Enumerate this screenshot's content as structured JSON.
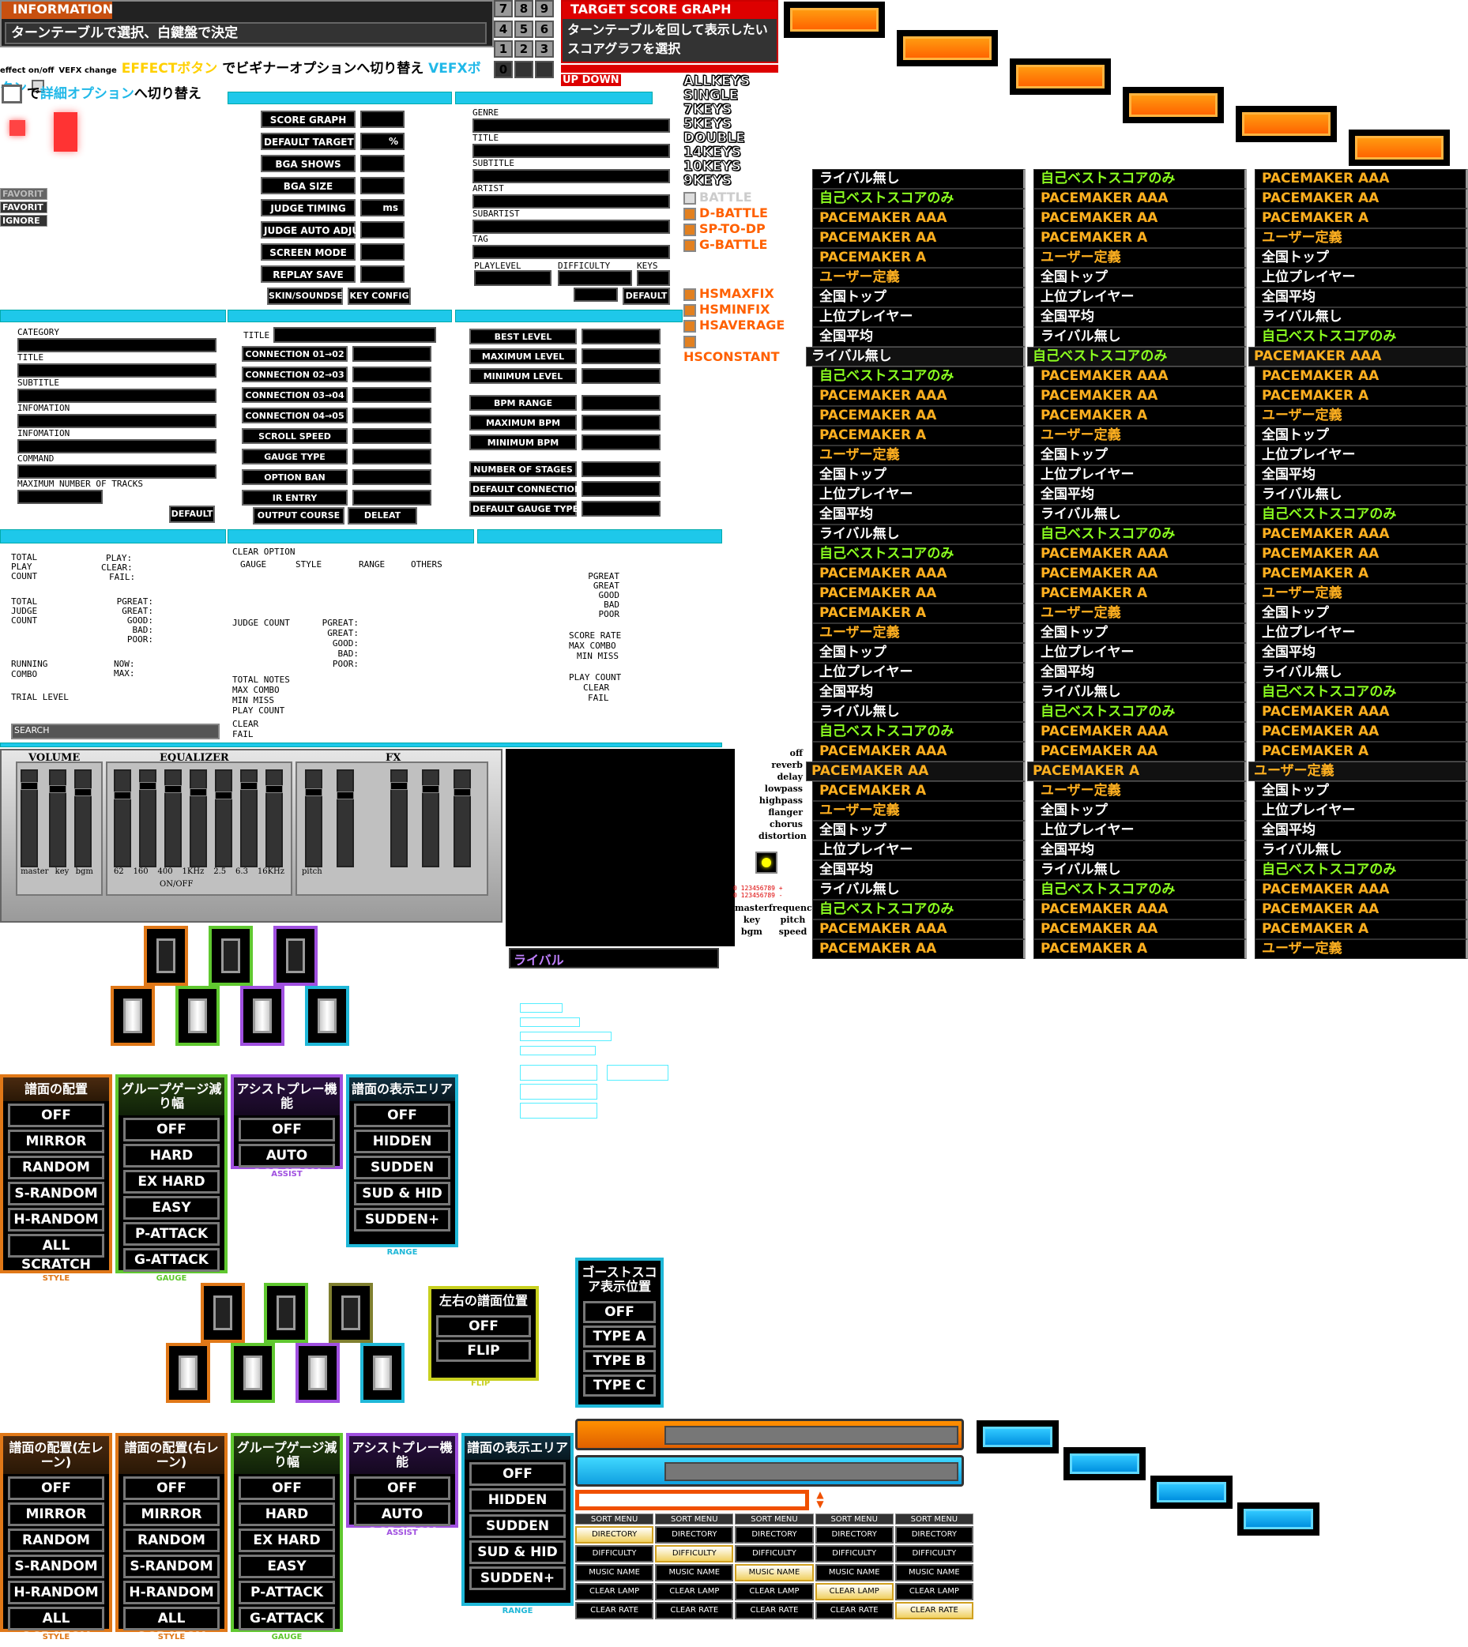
{
  "info": {
    "header": "INFORMATION",
    "line1": "ターンテーブルで選択、白鍵盤で決定",
    "line2a": "effect on/off",
    "line2b": "VEFX change",
    "line2c": "EFFECTボタン",
    "line2d": "でビギナーオプションへ切り替え",
    "line2e": "VEFXボタン",
    "line3a": "で",
    "line3b": "詳細オプション",
    "line3c": "へ切り替え"
  },
  "keypad": [
    "7",
    "8",
    "9",
    "4",
    "5",
    "6",
    "1",
    "2",
    "3",
    "0"
  ],
  "target": {
    "header": "TARGET SCORE GRAPH",
    "line1": "ターンテーブルを回して表示したい",
    "line2": "スコアグラフを選択",
    "updown": "UP DOWN"
  },
  "keysmode": [
    "ALLKEYS",
    "SINGLE",
    "7KEYS",
    "5KEYS",
    "DOUBLE",
    "14KEYS",
    "10KEYS",
    "9KEYS"
  ],
  "battle": [
    "BATTLE",
    "D-BATTLE",
    "SP-TO-DP",
    "G-BATTLE"
  ],
  "hs": [
    "HSMAXFIX",
    "HSMINFIX",
    "HSAVERAGE",
    "HSCONSTANT"
  ],
  "favorite": [
    "FAVORIT",
    "FAVORIT",
    "IGNORE"
  ],
  "settings": {
    "items": [
      "SCORE GRAPH",
      "DEFAULT TARGET",
      "BGA SHOWS",
      "BGA SIZE",
      "JUDGE TIMING",
      "JUDGE AUTO ADJUST",
      "SCREEN MODE",
      "REPLAY SAVE"
    ],
    "units": [
      "",
      "%",
      "",
      "",
      "ms",
      "",
      "",
      ""
    ],
    "skin": "SKIN/SOUNDSET",
    "keyconfig": "KEY CONFIG"
  },
  "songinfo": {
    "labels": [
      "GENRE",
      "TITLE",
      "SUBTITLE",
      "ARTIST",
      "SUBARTIST",
      "TAG"
    ],
    "playlevel": "PLAYLEVEL",
    "difficulty": "DIFFICULTY",
    "keys": "KEYS",
    "default": "DEFAULT"
  },
  "course": {
    "labels": [
      "CATEGORY",
      "TITLE",
      "SUBTITLE",
      "INFOMATION",
      "INFOMATION",
      "COMMAND",
      "MAXIMUM NUMBER OF TRACKS"
    ],
    "default": "DEFAULT"
  },
  "course2": {
    "title": "TITLE",
    "items": [
      "CONNECTION 01→02",
      "CONNECTION 02→03",
      "CONNECTION 03→04",
      "CONNECTION 04→05",
      "SCROLL SPEED",
      "GAUGE TYPE",
      "OPTION BAN",
      "IR ENTRY"
    ],
    "output": "OUTPUT COURSE FILE",
    "delete": "DELEAT COURSE"
  },
  "course3": {
    "items": [
      "BEST LEVEL",
      "MAXIMUM LEVEL",
      "MINIMUM LEVEL",
      "BPM RANGE",
      "MAXIMUM BPM",
      "MINIMUM BPM",
      "NUMBER OF STAGES",
      "DEFAULT CONNECTION",
      "DEFAULT GAUGE TYPE"
    ]
  },
  "stats": {
    "total_play": "TOTAL PLAY COUNT",
    "play": "PLAY:",
    "clear": "CLEAR:",
    "fail": "FAIL:",
    "total_judge": "TOTAL JUDGE COUNT",
    "judges": [
      "PGREAT:",
      "GREAT:",
      "GOOD:",
      "BAD:",
      "POOR:"
    ],
    "running": "RUNNING COMBO",
    "now": "NOW:",
    "max": "MAX:",
    "trial": "TRIAL LEVEL",
    "search": "SEARCH"
  },
  "clearopt": {
    "title": "CLEAR OPTION",
    "gauge": "GAUGE",
    "style": "STYLE",
    "range": "RANGE",
    "others": "OTHERS",
    "judgecount": "JUDGE COUNT",
    "totals": [
      "TOTAL NOTES",
      "MAX COMBO",
      "MIN MISS",
      "PLAY COUNT"
    ],
    "cf": [
      "CLEAR",
      "FAIL"
    ]
  },
  "score": {
    "judges": [
      "PGREAT",
      "GREAT",
      "GOOD",
      "BAD",
      "POOR"
    ],
    "rate": "SCORE RATE",
    "maxcombo": "MAX COMBO",
    "minmiss": "MIN MISS",
    "play": "PLAY COUNT",
    "clear": "CLEAR",
    "fail": "FAIL"
  },
  "mixer": {
    "volume": "VOLUME",
    "equalizer": "EQUALIZER",
    "fx": "FX",
    "vol_labels": [
      "master",
      "key",
      "bgm"
    ],
    "eq_labels": [
      "62",
      "160",
      "400",
      "1KHz",
      "2.5",
      "6.3",
      "16KHz"
    ],
    "onoff": "ON/OFF",
    "pitch": "pitch"
  },
  "fxlist": [
    "off",
    "reverb",
    "delay",
    "lowpass",
    "highpass",
    "flanger",
    "chorus",
    "distortion"
  ],
  "fxbottom": [
    "master",
    "frequency",
    "key",
    "pitch",
    "bgm",
    "speed"
  ],
  "rival": "ライバル",
  "options1": [
    {
      "title": "譜面の配置",
      "items": [
        "OFF",
        "MIRROR",
        "RANDOM",
        "S-RANDOM",
        "H-RANDOM",
        "ALL SCRATCH"
      ],
      "foot": "STYLE",
      "color": "#e07818"
    },
    {
      "title": "グループゲージ減り幅",
      "items": [
        "OFF",
        "HARD",
        "EX HARD",
        "EASY",
        "P-ATTACK",
        "G-ATTACK"
      ],
      "foot": "GAUGE",
      "color": "#60c830"
    },
    {
      "title": "アシストプレー機能",
      "items": [
        "OFF",
        "AUTO SCRATCH"
      ],
      "foot": "ASSIST",
      "color": "#a050e0"
    },
    {
      "title": "譜面の表示エリア",
      "items": [
        "OFF",
        "HIDDEN",
        "SUDDEN",
        "SUD & HID",
        "SUDDEN+"
      ],
      "foot": "RANGE",
      "color": "#20b8d8"
    }
  ],
  "options2": [
    {
      "title": "譜面の配置(左レーン)",
      "items": [
        "OFF",
        "MIRROR",
        "RANDOM",
        "S-RANDOM",
        "H-RANDOM",
        "ALL SCRATCH"
      ],
      "foot": "STYLE",
      "color": "#e07818"
    },
    {
      "title": "譜面の配置(右レーン)",
      "items": [
        "OFF",
        "MIRROR",
        "RANDOM",
        "S-RANDOM",
        "H-RANDOM",
        "ALL SCRATCH"
      ],
      "foot": "STYLE",
      "color": "#e07818"
    },
    {
      "title": "グループゲージ減り幅",
      "items": [
        "OFF",
        "HARD",
        "EX HARD",
        "EASY",
        "P-ATTACK",
        "G-ATTACK"
      ],
      "foot": "GAUGE",
      "color": "#60c830"
    },
    {
      "title": "アシストプレー機能",
      "items": [
        "OFF",
        "AUTO SCRATCH"
      ],
      "foot": "ASSIST",
      "color": "#a050e0"
    },
    {
      "title": "譜面の表示エリア",
      "items": [
        "OFF",
        "HIDDEN",
        "SUDDEN",
        "SUD & HID",
        "SUDDEN+"
      ],
      "foot": "RANGE",
      "color": "#20b8d8"
    }
  ],
  "flip": {
    "title": "左右の譜面位置",
    "items": [
      "OFF",
      "FLIP"
    ],
    "foot": "FLIP"
  },
  "ghost": {
    "title": "ゴーストスコア表示位置",
    "items": [
      "OFF",
      "TYPE A",
      "TYPE B",
      "TYPE C"
    ]
  },
  "sortmenu": {
    "header": "SORT MENU",
    "items": [
      "DIRECTORY",
      "DIFFICULTY",
      "MUSIC NAME",
      "CLEAR LAMP",
      "CLEAR RATE"
    ]
  },
  "targets": [
    "全国平均",
    "ライバル無し",
    "自己ベストスコアのみ",
    "PACEMAKER AAA",
    "PACEMAKER AA",
    "PACEMAKER A",
    "ユーザー定義",
    "全国トップ",
    "上位プレイヤー"
  ],
  "target_colors": {
    "全国平均": "#ffffff",
    "ライバル無し": "#ffffff",
    "自己ベストスコアのみ": "#8cff20",
    "PACEMAKER AAA": "#ffb020",
    "PACEMAKER AA": "#ffb020",
    "PACEMAKER A": "#ffb020",
    "ユーザー定義": "#ffb020",
    "全国トップ": "#ffffff",
    "上位プレイヤー": "#ffffff"
  }
}
